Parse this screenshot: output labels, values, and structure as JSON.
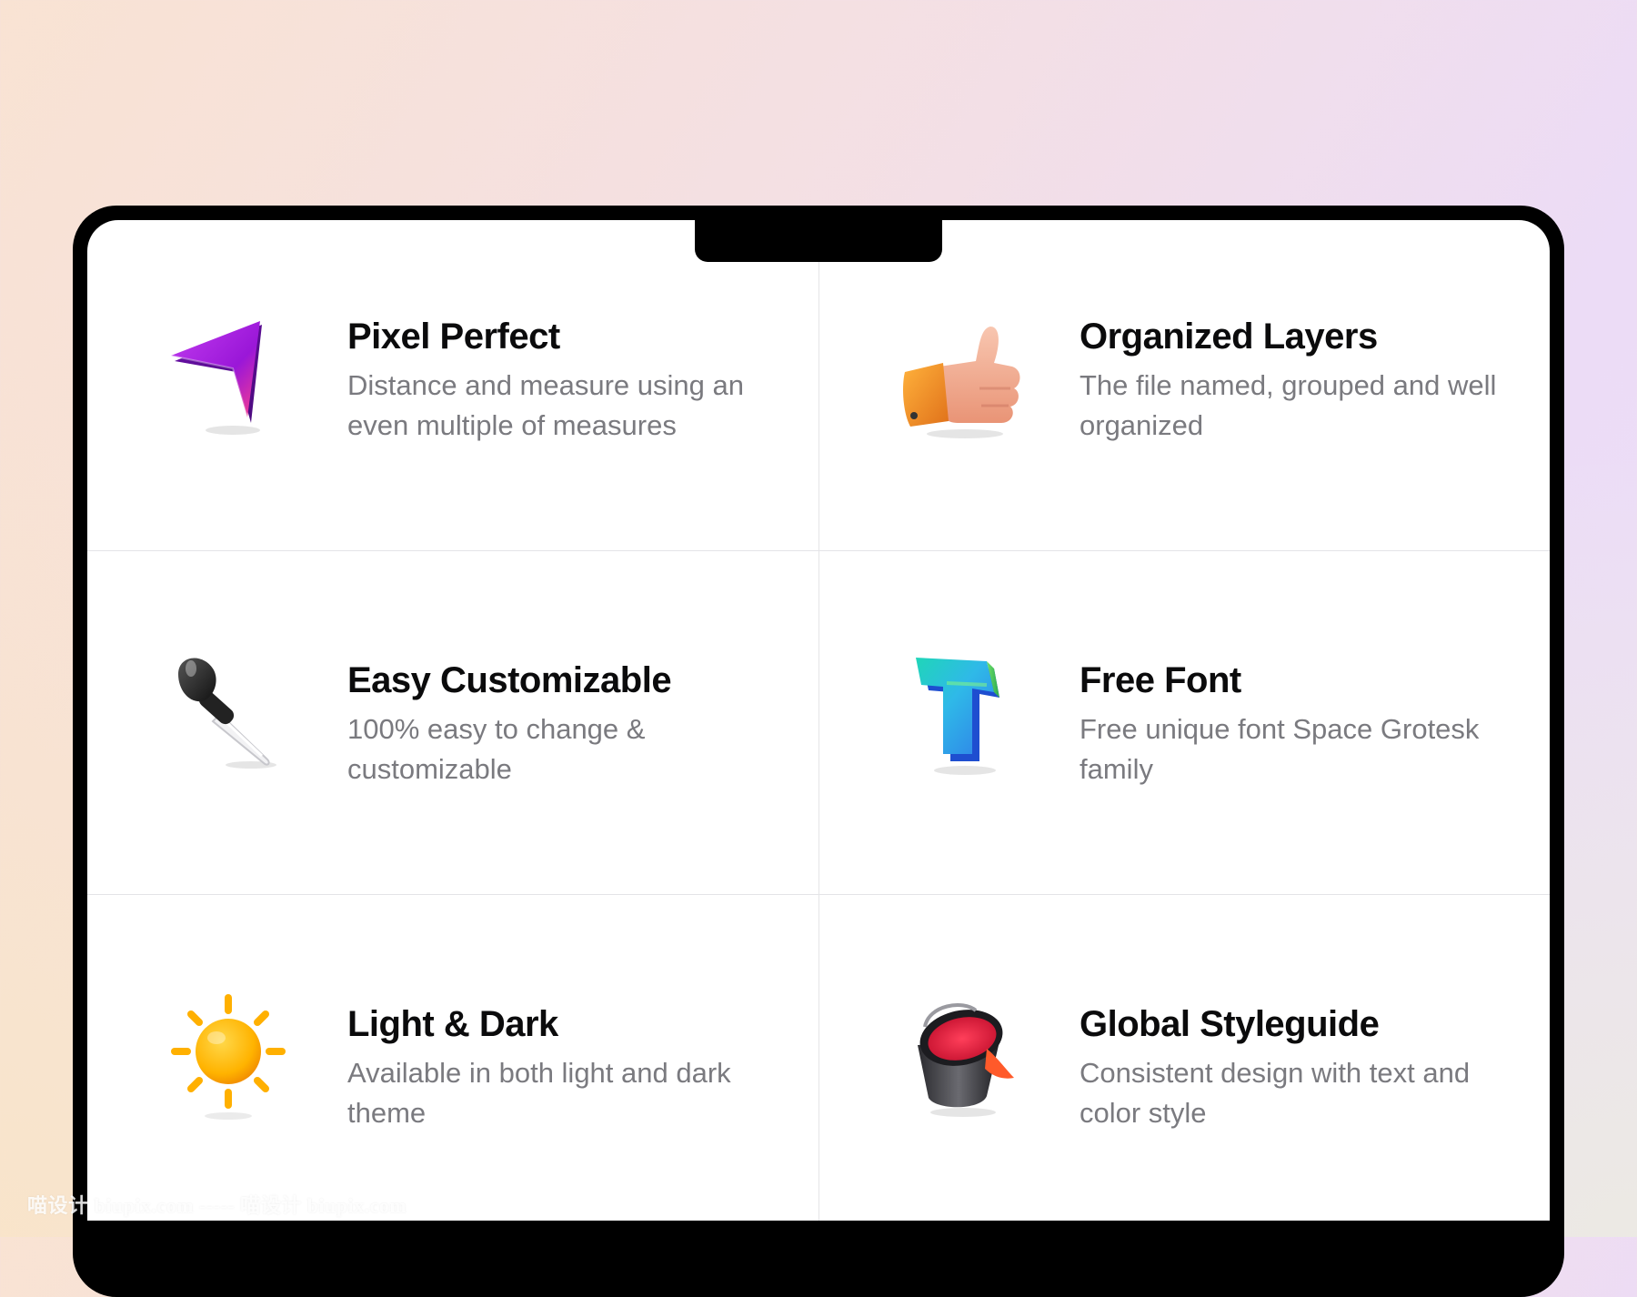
{
  "features": [
    {
      "title": "Pixel Perfect",
      "desc": "Distance and measure using an even multiple of measures",
      "icon": "cursor-arrow-icon"
    },
    {
      "title": "Organized Layers",
      "desc": "The file named, grouped and well organized",
      "icon": "thumbs-up-icon"
    },
    {
      "title": "Easy Customizable",
      "desc": "100% easy to change & customizable",
      "icon": "eyedropper-icon"
    },
    {
      "title": "Free Font",
      "desc": "Free unique font Space Grotesk family",
      "icon": "letter-t-icon"
    },
    {
      "title": "Light & Dark",
      "desc": "Available in both light and dark theme",
      "icon": "sun-icon"
    },
    {
      "title": "Global Styleguide",
      "desc": "Consistent design with text and color style",
      "icon": "paint-bucket-icon"
    }
  ],
  "watermark": "喵设计 biupix.com ----- 喵设计 biupix.com",
  "colors": {
    "title": "#0b0b0c",
    "description": "#7a7a7f",
    "divider": "#e4e4e7",
    "frame": "#000000"
  }
}
